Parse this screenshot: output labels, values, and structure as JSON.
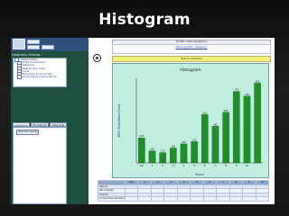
{
  "slide": {
    "title": "Histogram"
  },
  "left_panel": {
    "account": {
      "field1": "",
      "field2": "",
      "field3": ""
    },
    "section_label": "Geography Selector",
    "tree_items": [
      "United States",
      "State Comparison",
      "Alabama",
      "Nearby Sec Area",
      "Local",
      "Boundary to Local Sec",
      "Small Service Area Name"
    ],
    "tabs": [
      "Geography",
      "By Subject",
      "Data Sets"
    ],
    "selected_item": "Selected Geography"
  },
  "header": {
    "title": "Profile / Demographics",
    "category_label": "Demographic Category",
    "category_sub": "",
    "highlight_text": "Test & Graphics"
  },
  "chart_data": {
    "type": "bar",
    "title": "Histogram",
    "xlabel": "Score",
    "ylabel": "EPSC Enrollment Count",
    "categories": [
      "n/a",
      "1",
      "2",
      "3",
      "4",
      "5",
      "6",
      "7",
      "8",
      "9",
      "10"
    ],
    "values": [
      270,
      130,
      110,
      160,
      205,
      230,
      520,
      395,
      545,
      770,
      720,
      860
    ],
    "bar_color": "#1f8f2a",
    "plot_bg": "#bfeede"
  },
  "table": {
    "header": [
      "",
      "N/A",
      "1",
      "2",
      "3",
      "4",
      "5",
      "6",
      "7",
      "8",
      "9",
      "10"
    ],
    "rows": [
      [
        "Values",
        "",
        "",
        "",
        "",
        "",
        "",
        "",
        "",
        "",
        "",
        ""
      ],
      [
        "Percentage",
        "",
        "",
        "",
        "",
        "",
        "",
        "",
        "",
        "",
        "",
        ""
      ],
      [
        "Counts",
        "",
        "",
        "",
        "",
        "",
        "",
        "",
        "",
        "",
        "",
        ""
      ],
      [
        "Cumulative Number",
        "",
        "",
        "",
        "",
        "",
        "",
        "",
        "",
        "",
        "",
        ""
      ]
    ]
  }
}
